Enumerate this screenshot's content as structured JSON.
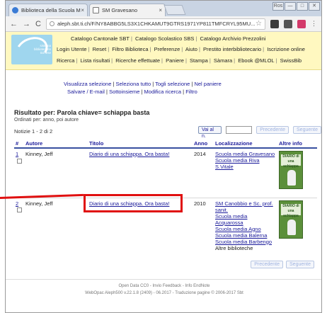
{
  "browser": {
    "tabs": [
      {
        "label": "Biblioteca della Scuola M",
        "close": "×"
      },
      {
        "label": "SM Gravesano",
        "close": "×"
      }
    ],
    "window_buttons": [
      "Ros",
      "—",
      "□",
      "✕"
    ],
    "url": "aleph.sbt.ti.ch/F/NY8ABBG5LS3X1CHKAMUT9GTRS1971YP811TMFCRYL95MU...",
    "back": "←",
    "forward": "→",
    "reload": "C"
  },
  "header": {
    "logo_text": "sistema bibliotecario ticinese",
    "row1": [
      "Catalogo Cantonale SBT",
      "Catalogo Scolastico SBS",
      "Catalogo Archivio Prezzolini"
    ],
    "row2": [
      "Login Utente",
      "Reset",
      "Filtro Biblioteca",
      "Preferenze",
      "Aiuto",
      "Prestito interbibliotecario",
      "Iscrizione online"
    ],
    "row3": [
      "Ricerca",
      "Lista risultati",
      "Ricerche effettuate",
      "Paniere",
      "Stampa",
      "Sàmara",
      "Ebook @MLOL",
      "SwissBib"
    ]
  },
  "actions": {
    "row1": [
      "Visualizza selezione",
      "Seleziona tutto",
      "Togli selezione",
      "Nel paniere"
    ],
    "row2": [
      "Salvare / E-mail",
      "Sottoinsieme",
      "Modifica ricerca",
      "Filtro"
    ]
  },
  "results": {
    "title": "Risultato per: Parola chiave= schiappa basta",
    "sorted": "Ordinati per: anno, poi autore",
    "count": "Notizie 1 - 2 di 2",
    "goto_label": "Vai al n.",
    "prev_label": "Precedente",
    "next_label": "Seguente",
    "columns": [
      "#",
      "Autore",
      "Titolo",
      "Anno",
      "Localizzazione",
      "Altre info"
    ],
    "rows": [
      {
        "num": "1",
        "author": "Kinney, Jeff",
        "title": "Diario di una schiappa. Ora basta!",
        "year": "2014",
        "locations": [
          "Scuola media Gravesano",
          "Scuola media Riva S.Vitale"
        ],
        "more": ""
      },
      {
        "num": "2",
        "author": "Kinney, Jeff",
        "title": "Diario di una schiappa. Ora basta!",
        "year": "2010",
        "locations": [
          "SM Canobbio e Sc. prof. sanit.",
          "Scuola media Acquarossa",
          "Scuola media Agno",
          "Scuola media Balerna",
          "Scuola media Barbengo"
        ],
        "more": "Altre biblioteche"
      }
    ],
    "cover_text": "DIARIO di una schiappa"
  },
  "footer": {
    "line1": "Open Data CC0 - Invio Feedback - Info EndNote",
    "line2": "WebOpac Aleph500 v.22.1.8 (2409) - 06.2017 - Traduzione pagine © 2006-2017 Sbt"
  },
  "colors": {
    "accent": "#1a1a9a",
    "header_bg": "#fff8c0",
    "highlight": "#e01010"
  }
}
